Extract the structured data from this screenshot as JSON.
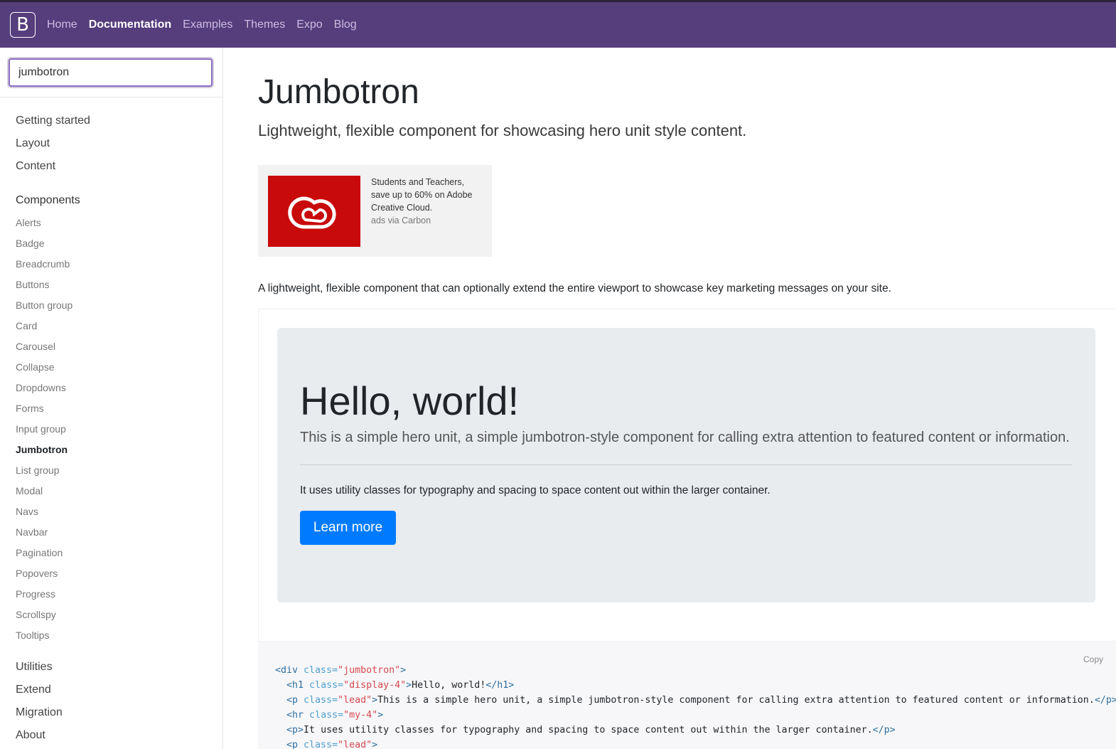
{
  "navbar": {
    "brand": "B",
    "links": [
      "Home",
      "Documentation",
      "Examples",
      "Themes",
      "Expo",
      "Blog"
    ],
    "active": "Documentation"
  },
  "sidebar": {
    "search_value": "jumbotron",
    "groups_top": [
      "Getting started",
      "Layout",
      "Content"
    ],
    "components_label": "Components",
    "components": [
      "Alerts",
      "Badge",
      "Breadcrumb",
      "Buttons",
      "Button group",
      "Card",
      "Carousel",
      "Collapse",
      "Dropdowns",
      "Forms",
      "Input group",
      "Jumbotron",
      "List group",
      "Modal",
      "Navs",
      "Navbar",
      "Pagination",
      "Popovers",
      "Progress",
      "Scrollspy",
      "Tooltips"
    ],
    "active_component": "Jumbotron",
    "groups_bottom": [
      "Utilities",
      "Extend",
      "Migration",
      "About"
    ]
  },
  "main": {
    "title": "Jumbotron",
    "lead": "Lightweight, flexible component for showcasing hero unit style content.",
    "ad": {
      "text": "Students and Teachers, save up to 60% on Adobe Creative Cloud.",
      "via": "ads via Carbon"
    },
    "intro": "A lightweight, flexible component that can optionally extend the entire viewport to showcase key marketing messages on your site.",
    "example": {
      "heading": "Hello, world!",
      "lead": "This is a simple hero unit, a simple jumbotron-style component for calling extra attention to featured content or information.",
      "text": "It uses utility classes for typography and spacing to space content out within the larger container.",
      "button": "Learn more"
    },
    "code": {
      "copy_label": "Copy",
      "line1_tag": "<div",
      "line1_attr": " class=",
      "line1_val": "\"jumbotron\"",
      "line1_end": ">",
      "line2_tag": "<h1",
      "line2_attr": " class=",
      "line2_val": "\"display-4\"",
      "line2_mid": ">",
      "line2_text": "Hello, world!",
      "line2_close": "</h1>",
      "line3_tag": "<p",
      "line3_attr": " class=",
      "line3_val": "\"lead\"",
      "line3_mid": ">",
      "line3_text": "This is a simple hero unit, a simple jumbotron-style component for calling extra attention to featured content or information.",
      "line3_close": "</p>",
      "line4_tag": "<hr",
      "line4_attr": " class=",
      "line4_val": "\"my-4\"",
      "line4_end": ">",
      "line5_tag": "<p>",
      "line5_text": "It uses utility classes for typography and spacing to space content out within the larger container.",
      "line5_close": "</p>",
      "line6_tag": "<p",
      "line6_attr": " class=",
      "line6_val": "\"lead\"",
      "line6_end": ">"
    }
  },
  "colors": {
    "navbar": "#563d7c",
    "button": "#007bff",
    "jumbotron_bg": "#e9ecef",
    "ad_logo_bg": "#c90a0a"
  }
}
